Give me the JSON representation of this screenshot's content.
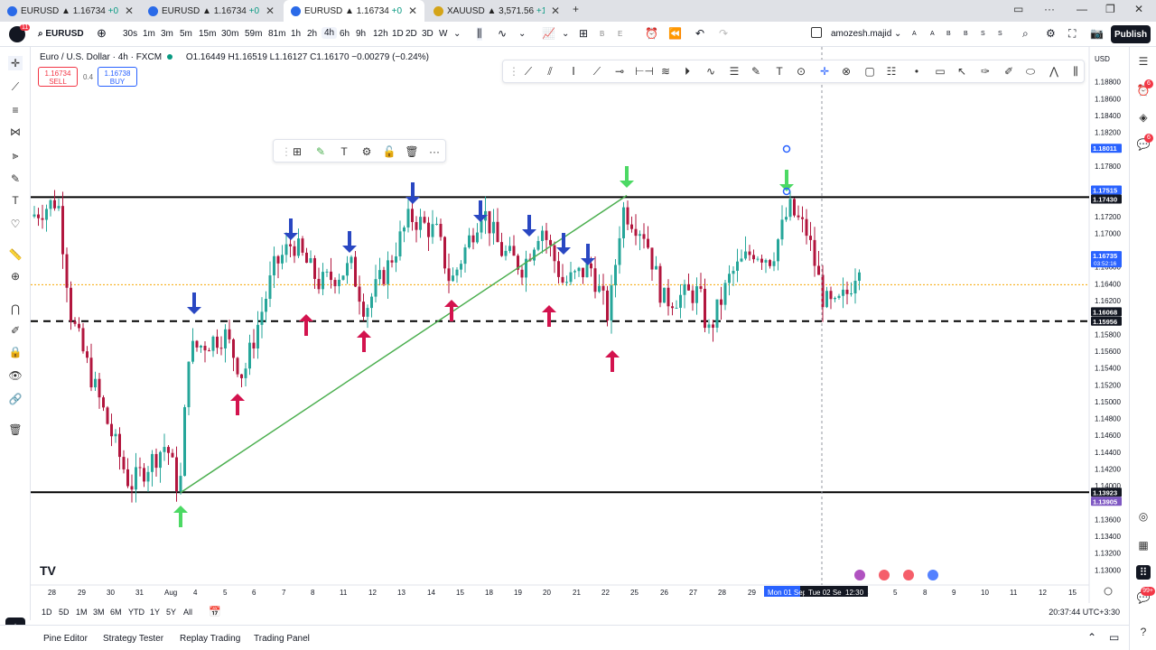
{
  "tabs": [
    {
      "symbol": "EURUSD",
      "price": "1.16734",
      "change": "+0.31%"
    },
    {
      "symbol": "EURUSD",
      "price": "1.16734",
      "change": "+0.31%"
    },
    {
      "symbol": "EURUSD",
      "price": "1.16734",
      "change": "+0.31%",
      "active": true
    },
    {
      "symbol": "XAUUSD",
      "price": "3,571.56",
      "change": "+1.11%"
    }
  ],
  "toolbar": {
    "symbol": "EURUSD",
    "intervals": [
      "30s",
      "1m",
      "3m",
      "5m",
      "15m",
      "30m",
      "59m",
      "81m",
      "1h",
      "2h",
      "4h",
      "6h",
      "9h",
      "12h",
      "1D",
      "2D",
      "3D",
      "W"
    ],
    "active_interval": "4h",
    "user": "amozesh.majid",
    "flags": [
      "A",
      "A",
      "B",
      "B",
      "S",
      "S"
    ],
    "publish": "Publish",
    "alert_count": "11"
  },
  "legend": {
    "title": "Euro / U.S. Dollar · 4h · FXCM",
    "ohlc": "O1.16449 H1.16519 L1.16127 C1.16170 −0.00279 (−0.24%)",
    "sell_price": "1.16734",
    "sell_label": "SELL",
    "spread": "0.4",
    "buy_price": "1.16738",
    "buy_label": "BUY"
  },
  "right_panel": {
    "currency": "USD",
    "badge1": "6",
    "badge2": "6",
    "badge3": "99+"
  },
  "chart_data": {
    "type": "candlestick",
    "y_axis": {
      "min": 1.128,
      "max": 1.19,
      "ticks": [
        "1.18800",
        "1.18600",
        "1.18400",
        "1.18200",
        "1.18000",
        "1.17800",
        "1.17400",
        "1.17200",
        "1.17000",
        "1.16600",
        "1.16400",
        "1.16200",
        "1.15800",
        "1.15600",
        "1.15400",
        "1.15200",
        "1.15000",
        "1.14800",
        "1.14600",
        "1.14400",
        "1.14200",
        "1.14000",
        "1.13600",
        "1.13400",
        "1.13200",
        "1.13000"
      ]
    },
    "x_axis": {
      "ticks": [
        "28",
        "29",
        "30",
        "31",
        "Aug",
        "4",
        "5",
        "6",
        "7",
        "8",
        "11",
        "12",
        "13",
        "14",
        "15",
        "18",
        "19",
        "20",
        "21",
        "22",
        "25",
        "26",
        "27",
        "28",
        "29",
        "Mon 01 Sep",
        "Tue 02 Sep '25",
        "12:30",
        "4",
        "5",
        "8",
        "9",
        "10",
        "11",
        "12",
        "15"
      ]
    },
    "price_labels": [
      {
        "value": "1.18011",
        "color": "#2962ff"
      },
      {
        "value": "1.17515",
        "color": "#2962ff"
      },
      {
        "value": "1.17430",
        "color": "#131722"
      },
      {
        "value": "1.16735",
        "color": "#2962ff",
        "sub": "03:52:16"
      },
      {
        "value": "1.16068",
        "color": "#131722"
      },
      {
        "value": "1.15956",
        "color": "#131722"
      },
      {
        "value": "1.13923",
        "color": "#131722"
      },
      {
        "value": "1.13905",
        "color": "#7e57c2"
      }
    ],
    "horizontal_lines": [
      {
        "price": 1.1743,
        "style": "solid"
      },
      {
        "price": 1.15956,
        "style": "dashed"
      },
      {
        "price": 1.13923,
        "style": "solid"
      },
      {
        "price": 1.1639,
        "style": "dotted",
        "color": "#f7a600"
      }
    ],
    "trend_line": {
      "from": [
        1.139,
        "Aug 1"
      ],
      "to": [
        1.1743,
        "Aug 25"
      ]
    },
    "markers": {
      "blue_down": 9,
      "red_up": 9,
      "green_up": 1,
      "green_down": 2
    }
  },
  "range": {
    "buttons": [
      "1D",
      "5D",
      "1M",
      "3M",
      "6M",
      "YTD",
      "1Y",
      "5Y",
      "All"
    ],
    "clock": "20:37:44 UTC+3:30"
  },
  "bottom": {
    "tabs": [
      "Pine Editor",
      "Strategy Tester",
      "Replay Trading",
      "Trading Panel"
    ]
  }
}
